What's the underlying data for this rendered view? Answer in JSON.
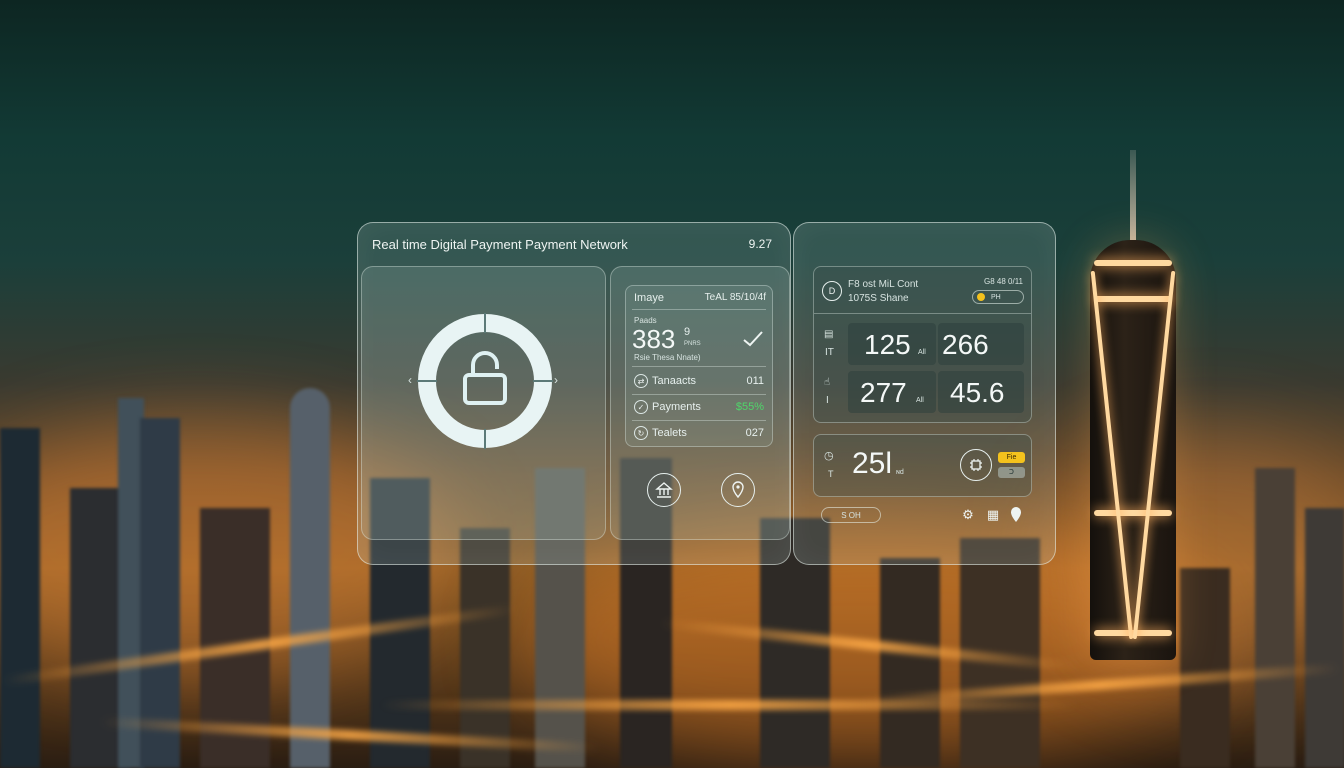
{
  "colors": {
    "accent_green": "#4fd66a",
    "accent_yellow": "#f4c21d",
    "glass_border": "#ebf5f0"
  },
  "panel_main": {
    "title": "Real time Digital Payment Payment Network",
    "time": "9.27"
  },
  "lock": {
    "icon": "lock-icon",
    "left_arrow": "‹",
    "right_arrow": "›"
  },
  "stats_card": {
    "header_left": "Imaye",
    "header_right": "TeAL 85/10/4f",
    "caption": "Paads",
    "big_value": "383",
    "big_suffix": "9",
    "big_small": "PNRS",
    "sub_caption": "Rsie Thesa Nnate)",
    "check_icon": "check-icon",
    "rows": [
      {
        "icon": "transfer-icon",
        "label": "Tanaacts",
        "value": "011",
        "highlight": false
      },
      {
        "icon": "shield-check-icon",
        "label": "Payments",
        "value": "$55%",
        "highlight": true
      },
      {
        "icon": "refresh-icon",
        "label": "Tealets",
        "value": "027",
        "highlight": false
      }
    ]
  },
  "bottom_icons": [
    {
      "icon": "bank-icon"
    },
    {
      "icon": "location-pin-icon"
    }
  ],
  "panel_right": {
    "metrics_card": {
      "title_line1": "F8 ost MiL Cont",
      "title_line2": "1075S Shane",
      "top_right": "G8 48 0/11",
      "pill_label": "PH",
      "row_icons": [
        "chart-icon",
        "hand-icon"
      ],
      "row_labels": [
        "IT",
        "I"
      ],
      "metrics": [
        {
          "value": "125",
          "unit": "All"
        },
        {
          "value": "266",
          "unit": ""
        },
        {
          "value": "277",
          "unit": "All"
        },
        {
          "value": "45.6",
          "unit": ""
        }
      ]
    },
    "summary_card": {
      "clock_icon": "clock-icon",
      "side_label": "T",
      "value": "25l",
      "unit": "ɴd",
      "chip_icon": "chip-icon",
      "badge_top": "Fie",
      "badge_bottom": "Ↄ",
      "button_label": "S OH",
      "footer_icons": [
        "settings-icon",
        "grid-icon",
        "location-icon"
      ]
    }
  }
}
